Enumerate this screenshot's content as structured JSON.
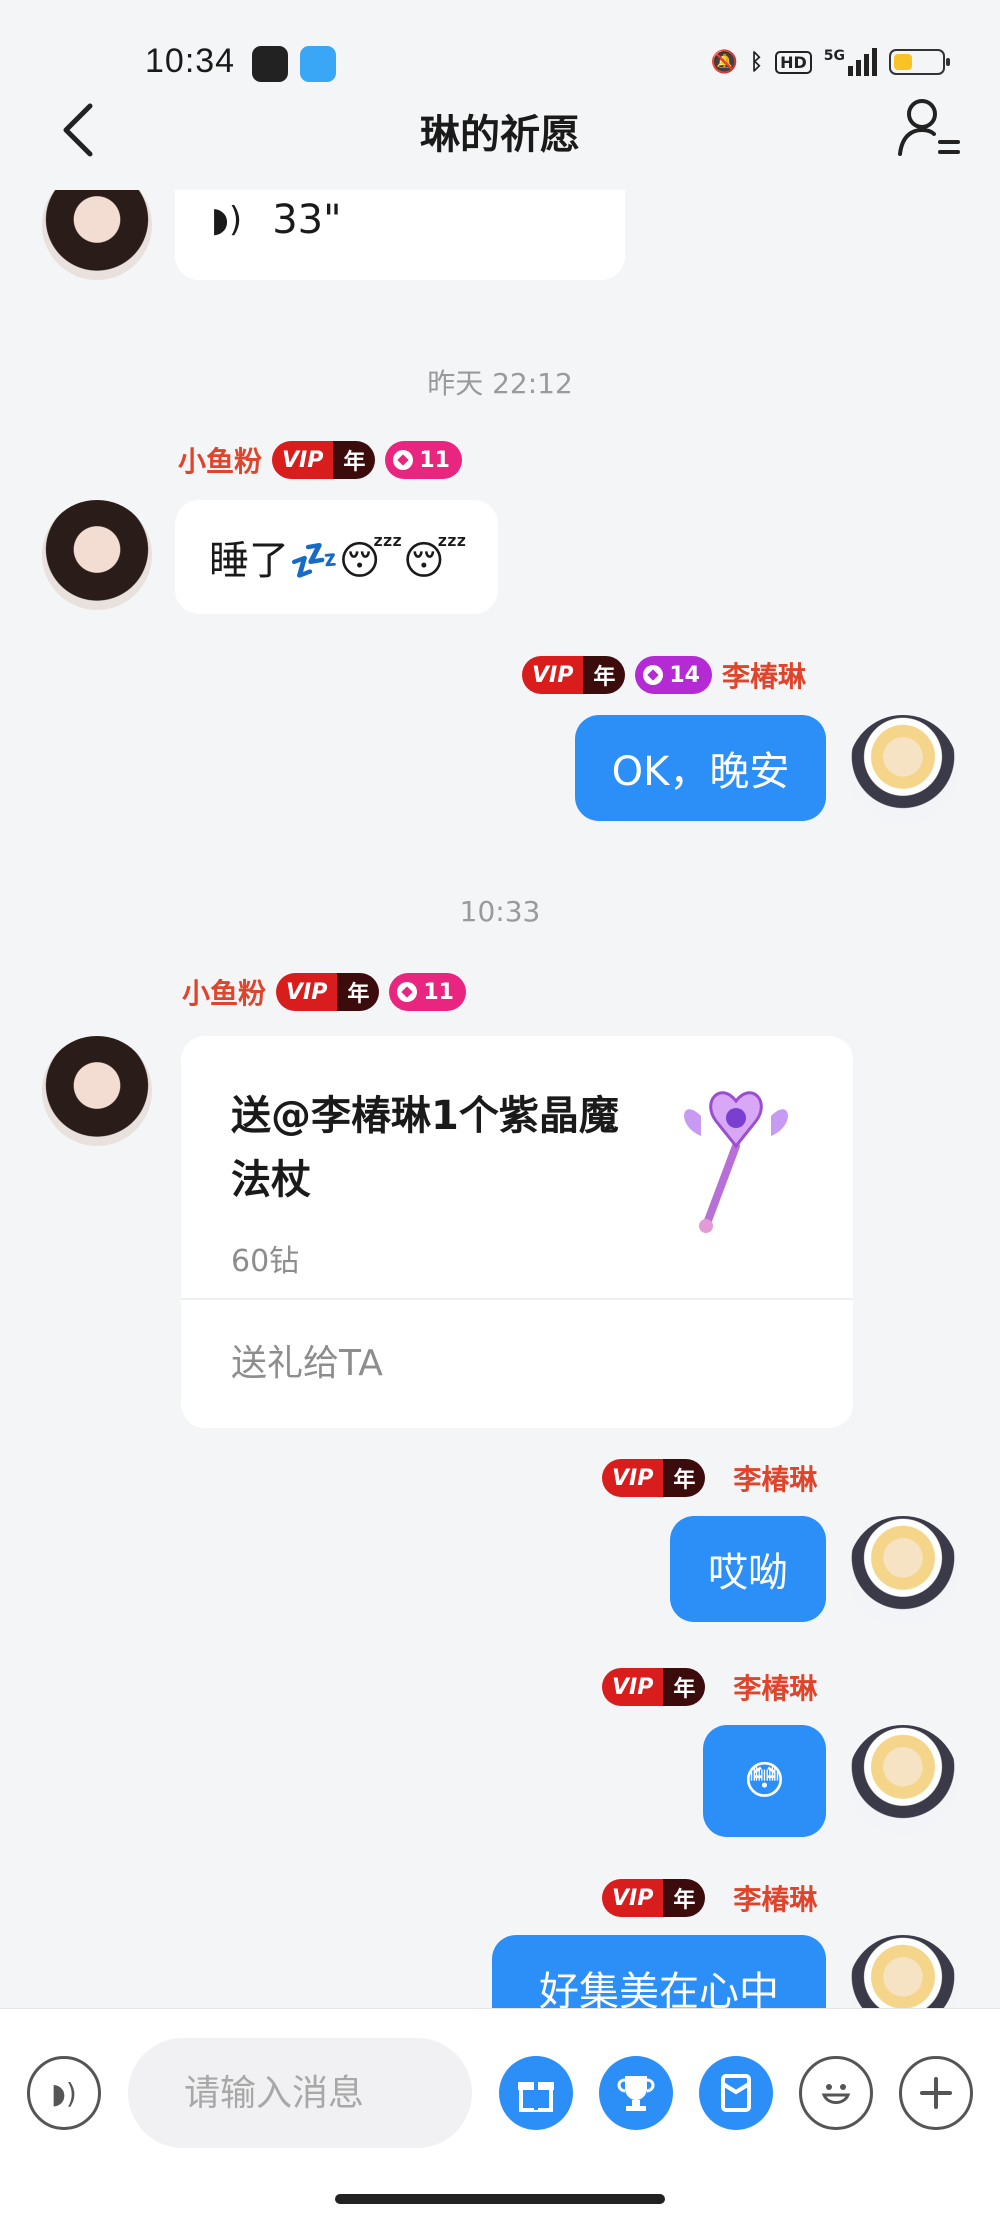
{
  "status_bar": {
    "time": "10:34",
    "network": "5G",
    "hd": "HD",
    "battery_level": 0.4
  },
  "header": {
    "title": "琳的祈愿"
  },
  "messages": {
    "voice": {
      "duration": "33\""
    },
    "ts1": "昨天 22:12",
    "m1": {
      "sender": "小鱼粉",
      "vip": "VIP",
      "year": "年",
      "level": "11",
      "text": "睡了💤😴😴"
    },
    "m2": {
      "sender": "李椿琳",
      "vip": "VIP",
      "year": "年",
      "level": "14",
      "text": "OK，晚安"
    },
    "ts2": "10:33",
    "m3": {
      "sender": "小鱼粉",
      "vip": "VIP",
      "year": "年",
      "level": "11"
    },
    "gift": {
      "text": "送@李椿琳1个紫晶魔法杖",
      "price": "60钻",
      "action": "送礼给TA"
    },
    "m4": {
      "sender": "李椿琳",
      "vip": "VIP",
      "year": "年",
      "text": "哎呦"
    },
    "m5": {
      "sender": "李椿琳",
      "vip": "VIP",
      "year": "年",
      "text": "😳"
    },
    "m6": {
      "sender": "李椿琳",
      "vip": "VIP",
      "year": "年",
      "text": "好集美在心中"
    }
  },
  "input": {
    "placeholder": "请输入消息"
  },
  "icons": {
    "accent": "#2b8ff7",
    "names": [
      "voice-icon",
      "gift-icon",
      "trophy-icon",
      "red-packet-icon",
      "emoji-icon",
      "plus-icon"
    ]
  }
}
